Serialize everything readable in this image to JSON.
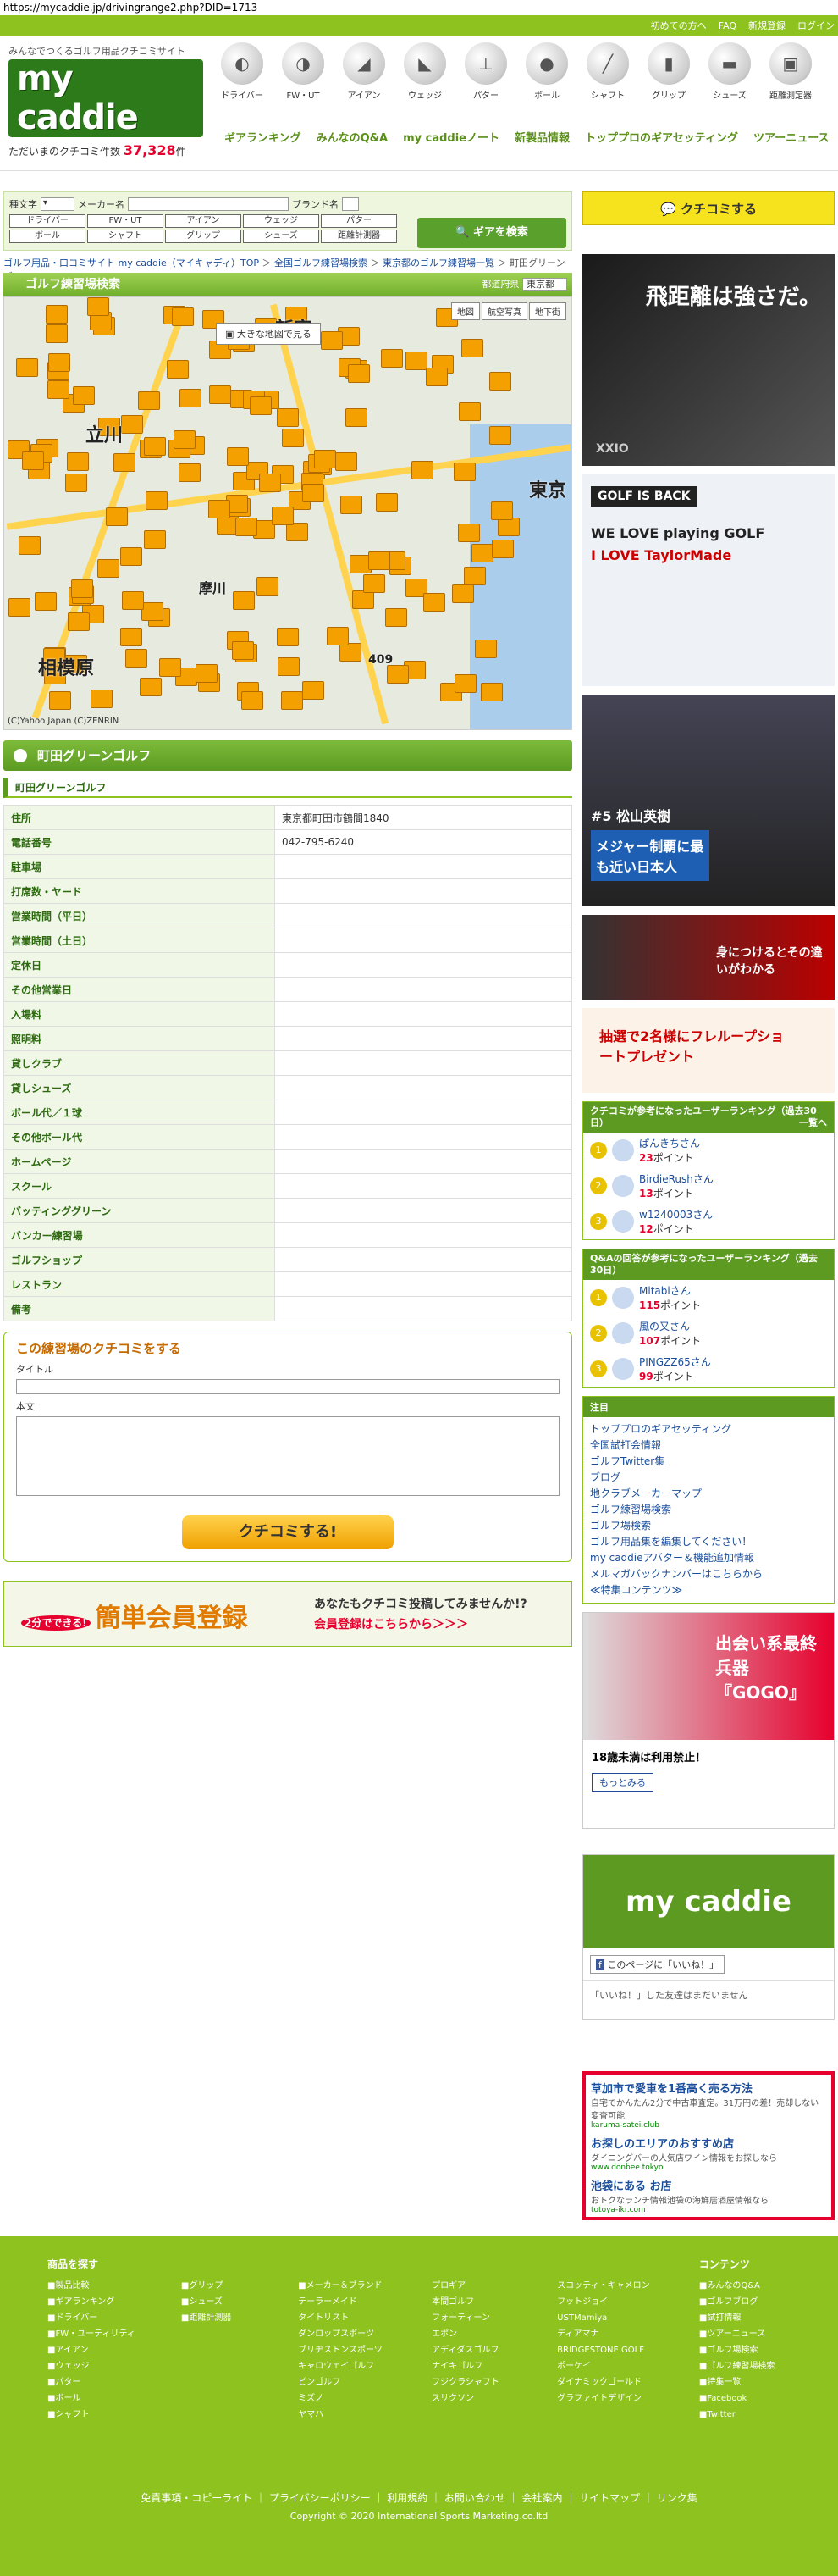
{
  "url": "https://mycaddie.jp/drivingrange2.php?DID=1713",
  "topbar": [
    "初めての方へ",
    "FAQ",
    "新規登録",
    "ログイン"
  ],
  "logo": {
    "tagline": "みんなでつくるゴルフ用品クチコミサイト",
    "name": "my caddie",
    "count_label": "ただいまのクチコミ件数",
    "count": "37,328",
    "count_unit": "件"
  },
  "categories": [
    "ドライバー",
    "FW・UT",
    "アイアン",
    "ウェッジ",
    "パター",
    "ボール",
    "シャフト",
    "グリップ",
    "シューズ",
    "距離測定器"
  ],
  "gnav": [
    "ギアランキング",
    "みんなのQ&A",
    "my caddieノート",
    "新製品情報",
    "トッププロのギアセッティング",
    "ツアーニュース"
  ],
  "search": {
    "l1": "種文字",
    "l2": "メーカー名",
    "l3": "ブランド名",
    "btns": [
      "ドライバー",
      "FW・UT",
      "アイアン",
      "ウェッジ",
      "パター",
      "ボール",
      "シャフト",
      "グリップ",
      "シューズ",
      "距離計測器"
    ],
    "gear_btn": "ギアを検索"
  },
  "kuchikomi_btn": "クチコミする",
  "breadcrumb": [
    "ゴルフ用品・口コミサイト my caddie（マイキャディ）TOP",
    "全国ゴルフ練習場検索",
    "東京都のゴルフ練習場一覧",
    "町田グリーンゴルフ"
  ],
  "map": {
    "title": "ゴルフ練習場検索",
    "pref_label": "都道府県",
    "pref": "東京都",
    "view_large": "大きな地図で見る",
    "types": [
      "地図",
      "航空写真",
      "地下街"
    ],
    "labels": [
      "新宿",
      "立川",
      "相模原",
      "摩川",
      "東京",
      "409"
    ],
    "copyright": "(C)Yahoo Japan (C)ZENRIN"
  },
  "facility": {
    "name": "町田グリーンゴルフ",
    "sub": "町田グリーンゴルフ"
  },
  "info": [
    [
      "住所",
      "東京都町田市鶴間1840"
    ],
    [
      "電話番号",
      "042-795-6240"
    ],
    [
      "駐車場",
      ""
    ],
    [
      "打席数・ヤード",
      ""
    ],
    [
      "営業時間（平日）",
      ""
    ],
    [
      "営業時間（土日）",
      ""
    ],
    [
      "定休日",
      ""
    ],
    [
      "その他営業日",
      ""
    ],
    [
      "入場料",
      ""
    ],
    [
      "照明料",
      ""
    ],
    [
      "貸しクラブ",
      ""
    ],
    [
      "貸しシューズ",
      ""
    ],
    [
      "ボール代／１球",
      ""
    ],
    [
      "その他ボール代",
      ""
    ],
    [
      "ホームページ",
      ""
    ],
    [
      "スクール",
      ""
    ],
    [
      "バッティンググリーン",
      ""
    ],
    [
      "バンカー練習場",
      ""
    ],
    [
      "ゴルフショップ",
      ""
    ],
    [
      "レストラン",
      ""
    ],
    [
      "備考",
      ""
    ]
  ],
  "kform": {
    "title": "この練習場のクチコミをする",
    "title_label": "タイトル",
    "body_label": "本文",
    "submit": "クチコミする!"
  },
  "register": {
    "badge": "2分でできる!",
    "big": "簡単会員登録",
    "t1": "あなたもクチコミ投稿してみませんか!?",
    "t2": "会員登録はこちらから＞＞＞"
  },
  "ads": {
    "a1": "飛距離は強さだ。",
    "a1b": "XXIO",
    "a2": "GOLF IS BACK",
    "a2b": "WE LOVE playing GOLF",
    "a2c": "I LOVE TaylorMade",
    "a3": "#5 松山英樹",
    "a3b": "メジャー制覇に最も近い日本人",
    "a4": "身につけるとその違いがわかる",
    "a5": "抽選で2名様にフレループショートプレゼント",
    "a6": "出会い系最終兵器『GOGO』",
    "a6b": "18歳未満は利用禁止！",
    "a6c": "もっとみる"
  },
  "rank1": {
    "title": "クチコミが参考になったユーザーランキング（過去30日）",
    "more": "一覧へ",
    "items": [
      [
        "1",
        "ぱんきちさん",
        "23",
        "ポイント"
      ],
      [
        "2",
        "BirdieRushさん",
        "13",
        "ポイント"
      ],
      [
        "3",
        "w1240003さん",
        "12",
        "ポイント"
      ]
    ]
  },
  "rank2": {
    "title": "Q&Aの回答が参考になったユーザーランキング（過去30日）",
    "items": [
      [
        "1",
        "Mitabiさん",
        "115",
        "ポイント"
      ],
      [
        "2",
        "風の又さん",
        "107",
        "ポイント"
      ],
      [
        "3",
        "PINGZZ65さん",
        "99",
        "ポイント"
      ]
    ]
  },
  "notice": {
    "title": "注目",
    "items": [
      "トッププロのギアセッティング",
      "全国試打会情報",
      "ゴルフTwitter集",
      "ブログ",
      "地クラブメーカーマップ",
      "ゴルフ練習場検索",
      "ゴルフ場検索",
      "ゴルフ用品集を編集してください！",
      "my caddieアバター＆機能追加情報",
      "メルマガバックナンバーはこちらから",
      "≪特集コンテンツ≫"
    ]
  },
  "fb": {
    "like": "このページに「いいね！」",
    "note": "「いいね！」した友達はまだいません"
  },
  "textads": [
    [
      "草加市で愛車を1番高く売る方法",
      "自宅でかんたん2分で中古車査定。31万円の差！売却しない変査可能",
      "karuma-satei.club"
    ],
    [
      "お探しのエリアのおすすめ店",
      "ダイニングバーの人気店ワイン情報をお探しなら",
      "www.donbee.tokyo"
    ],
    [
      "池袋にある お店",
      "おトクなランチ情報池袋の海鮮居酒屋情報なら",
      "totoya-ikr.com"
    ]
  ],
  "footer": {
    "h1": "商品を探す",
    "h2": "コンテンツ",
    "c1": [
      "■製品比較",
      "■ギアランキング",
      "■ドライバー",
      "■FW・ユーティリティ",
      "■アイアン",
      "■ウェッジ",
      "■パター",
      "■ボール",
      "■シャフト"
    ],
    "c2": [
      "■グリップ",
      "■シューズ",
      "■距離計測器"
    ],
    "c3": [
      "■メーカー＆ブランド",
      "テーラーメイド",
      "タイトリスト",
      "ダンロップスポーツ",
      "ブリヂストンスポーツ",
      "キャロウェイゴルフ",
      "ピンゴルフ",
      "ミズノ",
      "ヤマハ"
    ],
    "c4": [
      "プロギア",
      "本間ゴルフ",
      "フォーティーン",
      "エポン",
      "アディダスゴルフ",
      "ナイキゴルフ",
      "フジクラシャフト",
      "スリクソン"
    ],
    "c5": [
      "スコッティ・キャメロン",
      "フットジョイ",
      "USTMamiya",
      "ディアマナ",
      "BRIDGESTONE GOLF",
      "ポーケイ",
      "ダイナミックゴールド",
      "グラファイトデザイン"
    ],
    "c6": [
      "■みんなのQ&A",
      "■ゴルフブログ",
      "■試打情報",
      "■ツアーニュース",
      "■ゴルフ場検索",
      "■ゴルフ練習場検索",
      "■特集一覧",
      "■Facebook",
      "■Twitter"
    ],
    "links": "免責事項・コピーライト ｜ プライバシーポリシー ｜ 利用規約 ｜ お問い合わせ ｜ 会社案内 ｜ サイトマップ ｜ リンク集",
    "copyright": "Copyright © 2020 International Sports Marketing.co.ltd"
  }
}
